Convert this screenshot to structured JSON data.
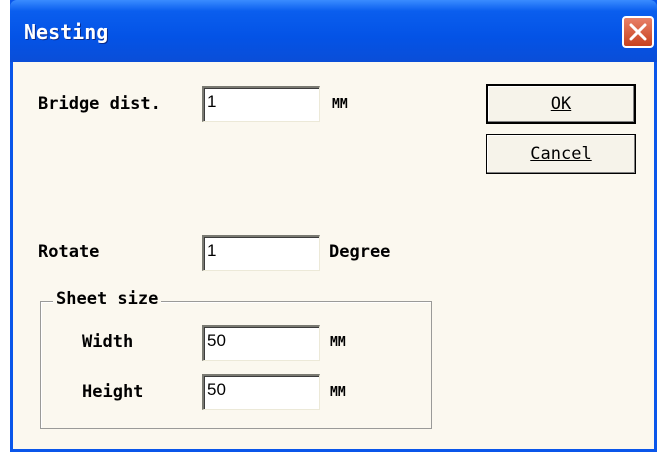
{
  "window": {
    "title": "Nesting"
  },
  "fields": {
    "bridge_dist": {
      "label": "Bridge dist.",
      "value": "1",
      "unit": "MM"
    },
    "rotate": {
      "label": "Rotate",
      "value": "1",
      "unit": "Degree"
    }
  },
  "sheet_size": {
    "legend": "Sheet size",
    "width": {
      "label": "Width",
      "value": "50",
      "unit": "MM"
    },
    "height": {
      "label": "Height",
      "value": "50",
      "unit": "MM"
    }
  },
  "buttons": {
    "ok": "OK",
    "cancel": "Cancel"
  },
  "colors": {
    "titlebar": "#0453e6",
    "client": "#fbf8ef",
    "close": "#d9542e"
  },
  "icons": {
    "close": "close-icon"
  }
}
